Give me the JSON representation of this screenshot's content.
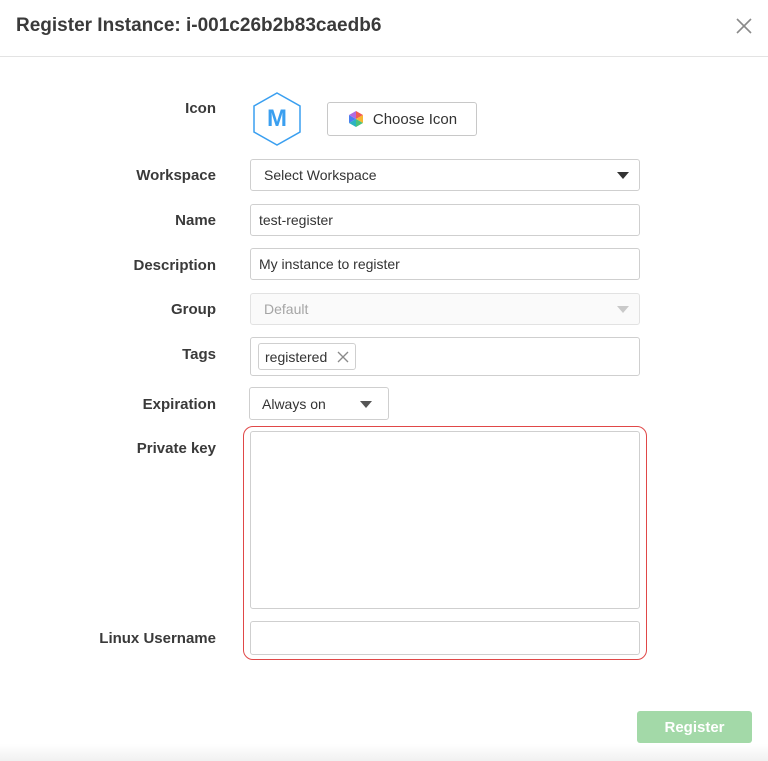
{
  "dialog": {
    "title": "Register Instance: i-001c26b2b83caedb6"
  },
  "form": {
    "icon": {
      "label": "Icon",
      "letter": "M",
      "choose_label": "Choose Icon"
    },
    "workspace": {
      "label": "Workspace",
      "value": "Select Workspace"
    },
    "name": {
      "label": "Name",
      "value": "test-register"
    },
    "description": {
      "label": "Description",
      "value": "My instance to register"
    },
    "group": {
      "label": "Group",
      "value": "Default",
      "disabled": true
    },
    "tags": {
      "label": "Tags",
      "items": [
        "registered"
      ]
    },
    "expiration": {
      "label": "Expiration",
      "value": "Always on"
    },
    "private_key": {
      "label": "Private key",
      "value": ""
    },
    "linux_username": {
      "label": "Linux Username",
      "value": ""
    }
  },
  "footer": {
    "register_label": "Register"
  },
  "colors": {
    "accent_blue": "#3a9ff0",
    "register_disabled_green": "#a3d9a8",
    "highlight_red": "#e04848"
  },
  "icons": {
    "close": "close-icon",
    "hexagon": "hexagon-icon",
    "palette": "palette-icon",
    "tag_remove": "close-icon",
    "dropdown": "caret-down-icon"
  }
}
